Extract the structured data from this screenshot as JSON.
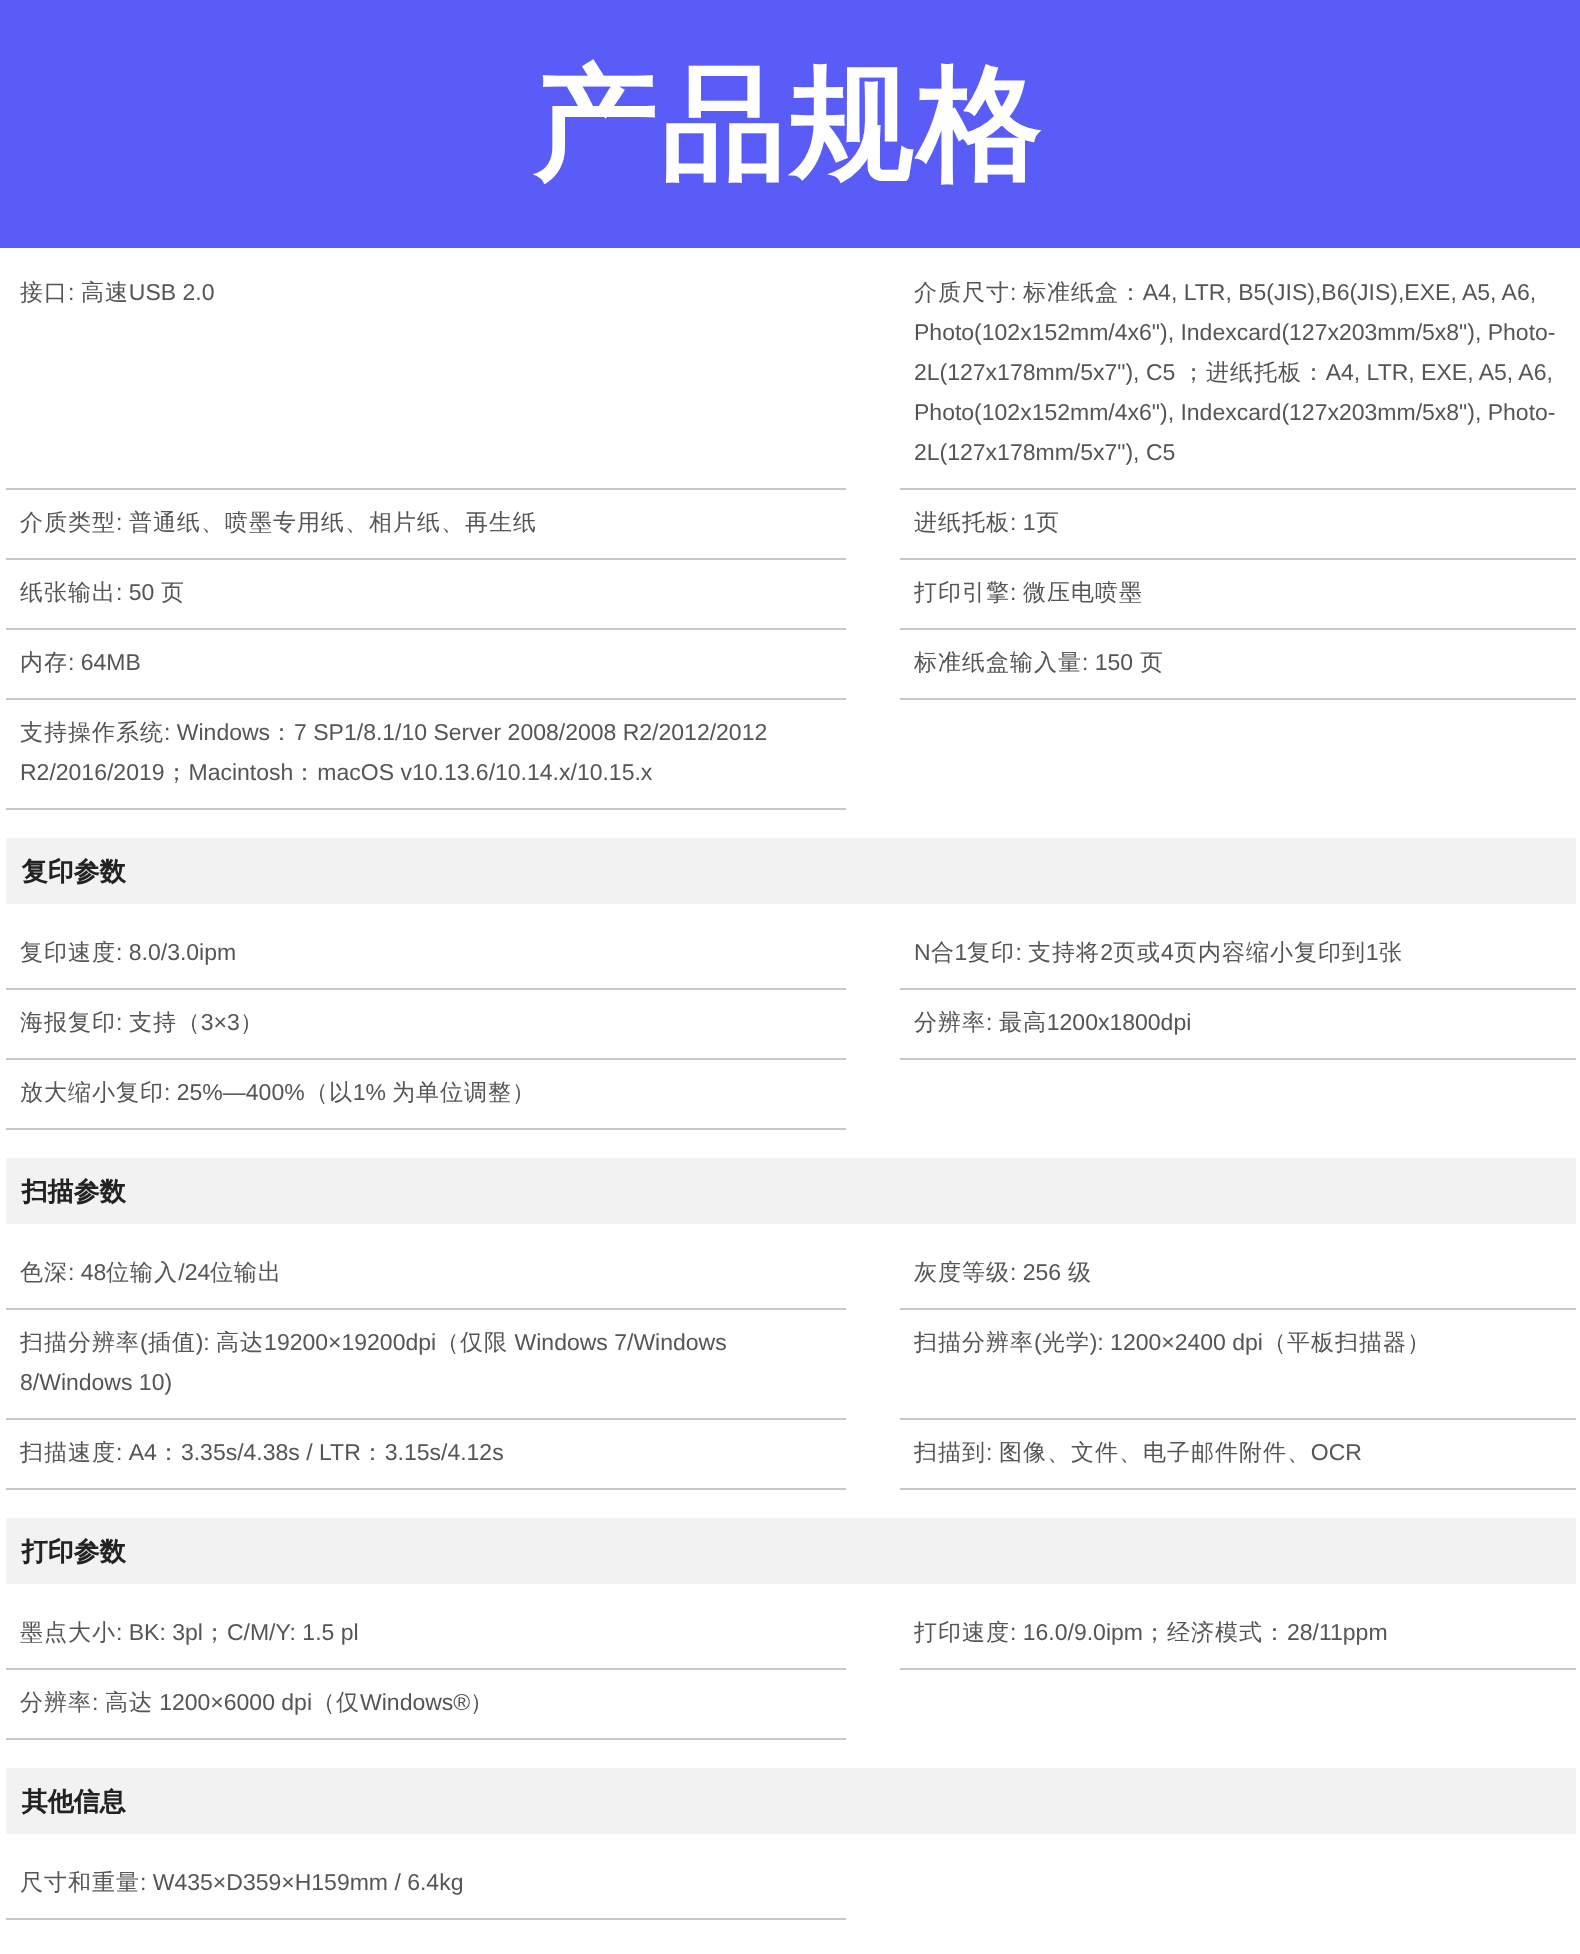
{
  "banner": {
    "title": "产品规格"
  },
  "sections": [
    {
      "rows": [
        {
          "cells": [
            "接口: 高速USB 2.0",
            "介质尺寸: 标准纸盒：A4, LTR, B5(JIS),B6(JIS),EXE, A5, A6, Photo(102x152mm/4x6\"), Indexcard(127x203mm/5x8\"), Photo-2L(127x178mm/5x7\"), C5 ；进纸托板：A4, LTR, EXE, A5, A6, Photo(102x152mm/4x6\"), Indexcard(127x203mm/5x8\"), Photo-2L(127x178mm/5x7\"), C5"
          ]
        },
        {
          "cells": [
            "介质类型: 普通纸、喷墨专用纸、相片纸、再生纸",
            "进纸托板: 1页"
          ]
        },
        {
          "cells": [
            "纸张输出: 50 页",
            "打印引擎: 微压电喷墨"
          ]
        },
        {
          "cells": [
            "内存: 64MB",
            "标准纸盒输入量: 150 页"
          ]
        },
        {
          "cells": [
            "支持操作系统: Windows：7 SP1/8.1/10 Server 2008/2008 R2/2012/2012 R2/2016/2019；Macintosh：macOS v10.13.6/10.14.x/10.15.x"
          ]
        }
      ]
    },
    {
      "heading": "复印参数",
      "rows": [
        {
          "cells": [
            "复印速度: 8.0/3.0ipm",
            "N合1复印: 支持将2页或4页内容缩小复印到1张"
          ]
        },
        {
          "cells": [
            "海报复印: 支持（3×3）",
            "分辨率: 最高1200x1800dpi"
          ]
        },
        {
          "cells": [
            "放大缩小复印: 25%—400%（以1% 为单位调整）"
          ]
        }
      ]
    },
    {
      "heading": "扫描参数",
      "rows": [
        {
          "cells": [
            "色深: 48位输入/24位输出",
            "灰度等级: 256 级"
          ]
        },
        {
          "cells": [
            "扫描分辨率(插值): 高达19200×19200dpi（仅限 Windows 7/Windows 8/Windows 10)",
            "扫描分辨率(光学): 1200×2400 dpi（平板扫描器）"
          ]
        },
        {
          "cells": [
            "扫描速度: A4：3.35s/4.38s / LTR：3.15s/4.12s",
            "扫描到: 图像、文件、电子邮件附件、OCR"
          ]
        }
      ]
    },
    {
      "heading": "打印参数",
      "rows": [
        {
          "cells": [
            "墨点大小: BK: 3pl；C/M/Y: 1.5 pl",
            "打印速度: 16.0/9.0ipm；经济模式：28/11ppm"
          ]
        },
        {
          "cells": [
            "分辨率: 高达 1200×6000 dpi（仅Windows®）"
          ]
        }
      ]
    },
    {
      "heading": "其他信息",
      "rows": [
        {
          "cells": [
            "尺寸和重量: W435×D359×H159mm / 6.4kg"
          ]
        }
      ]
    }
  ]
}
